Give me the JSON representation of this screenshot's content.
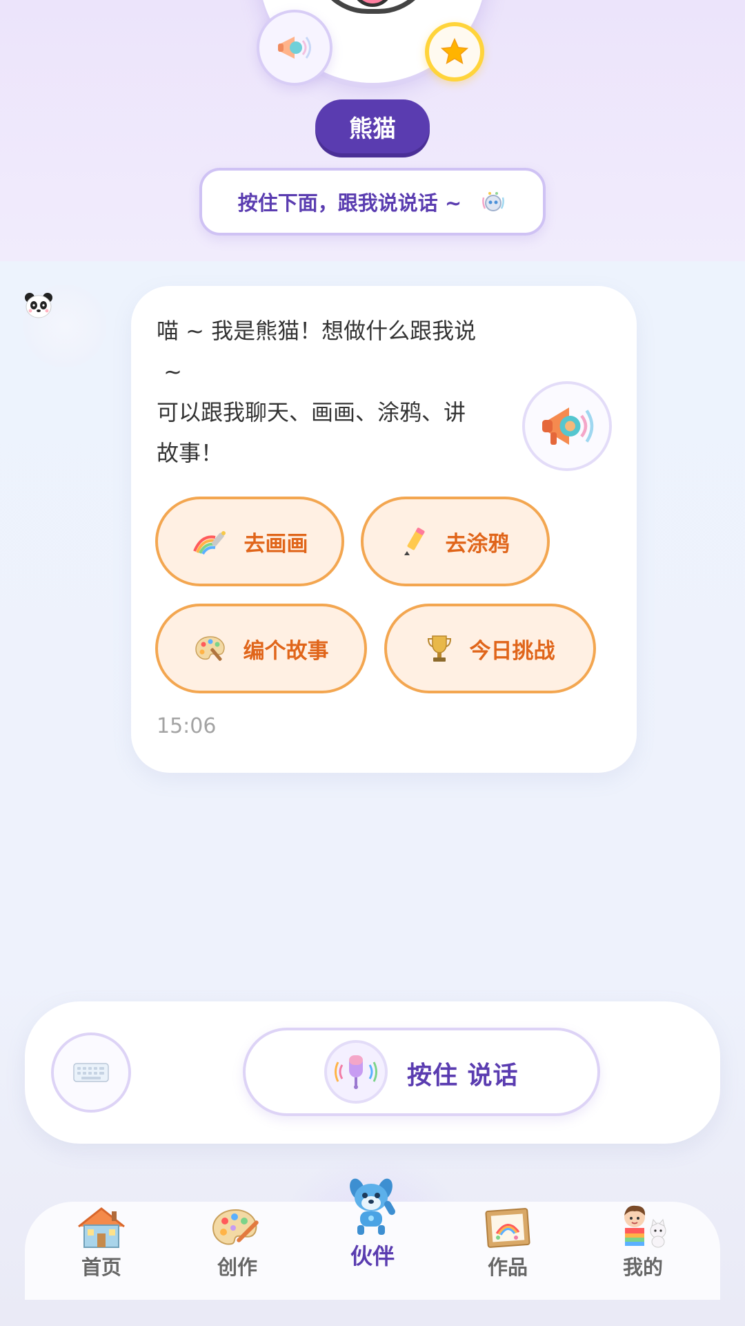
{
  "header": {
    "character_name": "熊猫",
    "hint_text": "按住下面，跟我说说话 ~"
  },
  "chat": {
    "message_text": "喵 ~ 我是熊猫！想做什么跟我说\n ~\n可以跟我聊天、画画、涂鸦、讲\n故事！",
    "timestamp": "15:06",
    "actions": [
      {
        "label": "去画画",
        "icon": "rainbow-brush-icon"
      },
      {
        "label": "去涂鸦",
        "icon": "pencil-icon"
      },
      {
        "label": "编个故事",
        "icon": "palette-icon"
      },
      {
        "label": "今日挑战",
        "icon": "trophy-icon"
      }
    ]
  },
  "input": {
    "talk_label": "按住 说话",
    "keyboard_icon": "keyboard-icon",
    "mic_icon": "microphone-icon"
  },
  "tabbar": {
    "items": [
      {
        "label": "首页",
        "icon": "house-icon"
      },
      {
        "label": "创作",
        "icon": "palette-icon"
      },
      {
        "label": "伙伴",
        "icon": "robot-dog-icon",
        "active": true
      },
      {
        "label": "作品",
        "icon": "framed-picture-icon"
      },
      {
        "label": "我的",
        "icon": "kid-and-cat-icon"
      }
    ]
  },
  "colors": {
    "primary_purple": "#5a3cb0",
    "action_orange": "#e0651a",
    "action_border": "#f3a650",
    "star_yellow": "#ffd43b"
  }
}
